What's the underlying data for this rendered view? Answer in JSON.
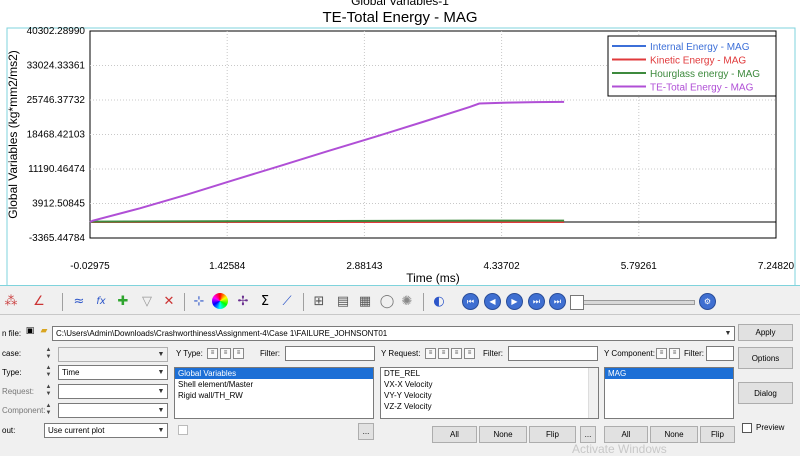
{
  "window": {
    "title": "Global Variables-1"
  },
  "chart_data": {
    "type": "line",
    "title": "TE-Total Energy - MAG",
    "xlabel": "Time (ms)",
    "ylabel": "Global Variables (kg*mm2/ms2)",
    "xlim": [
      -0.02975,
      7.2482
    ],
    "ylim": [
      -3365.44784,
      40302.2899
    ],
    "x_ticks": [
      "-0.02975",
      "1.42584",
      "2.88143",
      "4.33702",
      "5.79261",
      "7.24820"
    ],
    "y_ticks": [
      "40302.28990",
      "33024.33361",
      "25746.37732",
      "18468.42103",
      "11190.46474",
      "3912.50845",
      "-3365.44784"
    ],
    "grid": true,
    "legend_position": "top-right",
    "series": [
      {
        "name": "Internal Energy - MAG",
        "color": "#3c6fd8",
        "x": [
          -0.02975,
          0.0,
          5.0
        ],
        "y": [
          0,
          0,
          0
        ]
      },
      {
        "name": "Kinetic Energy - MAG",
        "color": "#e0393b",
        "x": [
          -0.02975,
          0.0,
          5.0
        ],
        "y": [
          0,
          0,
          0
        ]
      },
      {
        "name": "Hourglass energy - MAG",
        "color": "#3d8a3d",
        "x": [
          -0.02975,
          0.0,
          2.0,
          4.0,
          5.0
        ],
        "y": [
          0,
          100,
          200,
          300,
          300
        ]
      },
      {
        "name": "TE-Total Energy - MAG",
        "color": "#b04fd6",
        "x": [
          -0.02975,
          0.0,
          0.5,
          1.0,
          1.5,
          2.0,
          2.5,
          3.0,
          3.5,
          4.0,
          4.1,
          4.4,
          4.7,
          5.0
        ],
        "y": [
          0,
          280,
          2900,
          5800,
          8900,
          11900,
          15000,
          18000,
          21100,
          24300,
          25000,
          25200,
          25300,
          25350
        ]
      }
    ]
  },
  "toolbar": {
    "icons": [
      "plot-type-icon",
      "curve-math-icon",
      "fx-function-icon",
      "add-curve-icon",
      "filter-icon",
      "delete-curve-icon",
      "axis-icon",
      "color-wheel-icon",
      "crosshair-icon",
      "sigma-icon",
      "measure-icon",
      "grid-icon",
      "legend-icon",
      "table-icon",
      "note-icon",
      "settings-icon",
      "animation-toggle-icon"
    ],
    "nav": [
      "first-frame",
      "prev-frame",
      "play",
      "next-frame",
      "last-frame"
    ]
  },
  "panel": {
    "file_label": "n file:",
    "file_path": "C:\\Users\\Admin\\Downloads\\Crashworthiness\\Assignment-4\\Case 1\\FAILURE_JOHNSONT01",
    "apply_label": "Apply",
    "options_label": "Options",
    "dialog_label": "Dialog",
    "preview_label": "Preview",
    "subcase_label": "case:",
    "x_type_label": "Type:",
    "x_type_value": "Time",
    "x_request_label": "Request:",
    "x_component_label": "Component:",
    "layout_label": "out:",
    "layout_value": "Use current plot",
    "ellipsis": "...",
    "y_type_label": "Y Type:",
    "y_type_filter": "Filter:",
    "y_types": [
      "Global Variables",
      "Shell element/Master",
      "Rigid wall/TH_RW"
    ],
    "y_request_label": "Y Request:",
    "y_request_filter": "Filter:",
    "y_requests": [
      "DTE_REL",
      "VX-X Velocity",
      "VY-Y Velocity",
      "VZ-Z Velocity"
    ],
    "y_component_label": "Y Component:",
    "y_component_filter": "Filter:",
    "y_components": [
      "MAG"
    ],
    "all_label": "All",
    "none_label": "None",
    "flip_label": "Flip",
    "watermark": "Activate Windows"
  }
}
